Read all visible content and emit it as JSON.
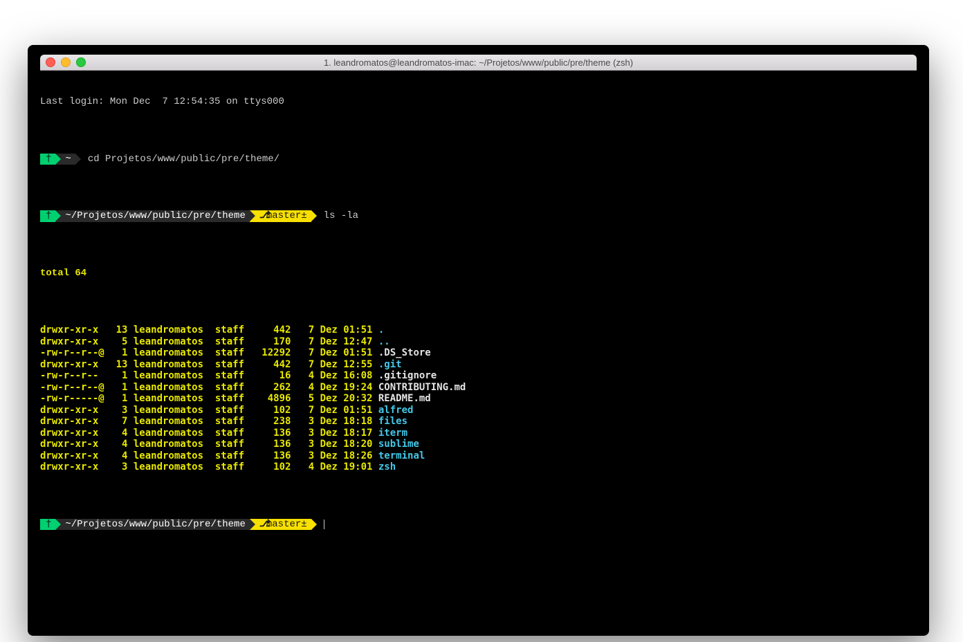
{
  "window": {
    "title": "1. leandromatos@leandromatos-imac: ~/Projetos/www/public/pre/theme (zsh)"
  },
  "lastLogin": "Last login: Mon Dec  7 12:54:35 on ttys000",
  "prompt1": {
    "icon": "†",
    "path": "~",
    "command": "cd Projetos/www/public/pre/theme/"
  },
  "prompt2": {
    "icon": "†",
    "path": "~/Projetos/www/public/pre/theme",
    "branchIcon": "⎇",
    "branch": "master±",
    "command": "ls -la"
  },
  "total": "total 64",
  "listing": [
    {
      "perm": "drwxr-xr-x ",
      "links": "13",
      "owner": "leandromatos",
      "group": "staff",
      "size": "442",
      "date": "7 Dez 01:51",
      "name": ".",
      "type": "dir"
    },
    {
      "perm": "drwxr-xr-x ",
      "links": "5",
      "owner": "leandromatos",
      "group": "staff",
      "size": "170",
      "date": "7 Dez 12:47",
      "name": "..",
      "type": "dir"
    },
    {
      "perm": "-rw-r--r--@",
      "links": "1",
      "owner": "leandromatos",
      "group": "staff",
      "size": "12292",
      "date": "7 Dez 01:51",
      "name": ".DS_Store",
      "type": "file"
    },
    {
      "perm": "drwxr-xr-x ",
      "links": "13",
      "owner": "leandromatos",
      "group": "staff",
      "size": "442",
      "date": "7 Dez 12:55",
      "name": ".git",
      "type": "dir"
    },
    {
      "perm": "-rw-r--r--",
      "links": "1",
      "owner": "leandromatos",
      "group": "staff",
      "size": "16",
      "date": "4 Dez 16:08",
      "name": ".gitignore",
      "type": "file"
    },
    {
      "perm": "-rw-r--r--@",
      "links": "1",
      "owner": "leandromatos",
      "group": "staff",
      "size": "262",
      "date": "4 Dez 19:24",
      "name": "CONTRIBUTING.md",
      "type": "file"
    },
    {
      "perm": "-rw-r-----@",
      "links": "1",
      "owner": "leandromatos",
      "group": "staff",
      "size": "4896",
      "date": "5 Dez 20:32",
      "name": "README.md",
      "type": "file"
    },
    {
      "perm": "drwxr-xr-x ",
      "links": "3",
      "owner": "leandromatos",
      "group": "staff",
      "size": "102",
      "date": "7 Dez 01:51",
      "name": "alfred",
      "type": "dir"
    },
    {
      "perm": "drwxr-xr-x ",
      "links": "7",
      "owner": "leandromatos",
      "group": "staff",
      "size": "238",
      "date": "3 Dez 18:18",
      "name": "files",
      "type": "dir"
    },
    {
      "perm": "drwxr-xr-x ",
      "links": "4",
      "owner": "leandromatos",
      "group": "staff",
      "size": "136",
      "date": "3 Dez 18:17",
      "name": "iterm",
      "type": "dir"
    },
    {
      "perm": "drwxr-xr-x ",
      "links": "4",
      "owner": "leandromatos",
      "group": "staff",
      "size": "136",
      "date": "3 Dez 18:20",
      "name": "sublime",
      "type": "dir"
    },
    {
      "perm": "drwxr-xr-x ",
      "links": "4",
      "owner": "leandromatos",
      "group": "staff",
      "size": "136",
      "date": "3 Dez 18:26",
      "name": "terminal",
      "type": "dir"
    },
    {
      "perm": "drwxr-xr-x ",
      "links": "3",
      "owner": "leandromatos",
      "group": "staff",
      "size": "102",
      "date": "4 Dez 19:01",
      "name": "zsh",
      "type": "dir"
    }
  ],
  "prompt3": {
    "icon": "†",
    "path": "~/Projetos/www/public/pre/theme",
    "branchIcon": "⎇",
    "branch": "master±"
  },
  "colors": {
    "green": "#00d070",
    "yellow": "#f8e000",
    "dirColor": "#44c8e8",
    "fileColor": "#e4e4e4",
    "promptYellowText": "#e8e800"
  }
}
